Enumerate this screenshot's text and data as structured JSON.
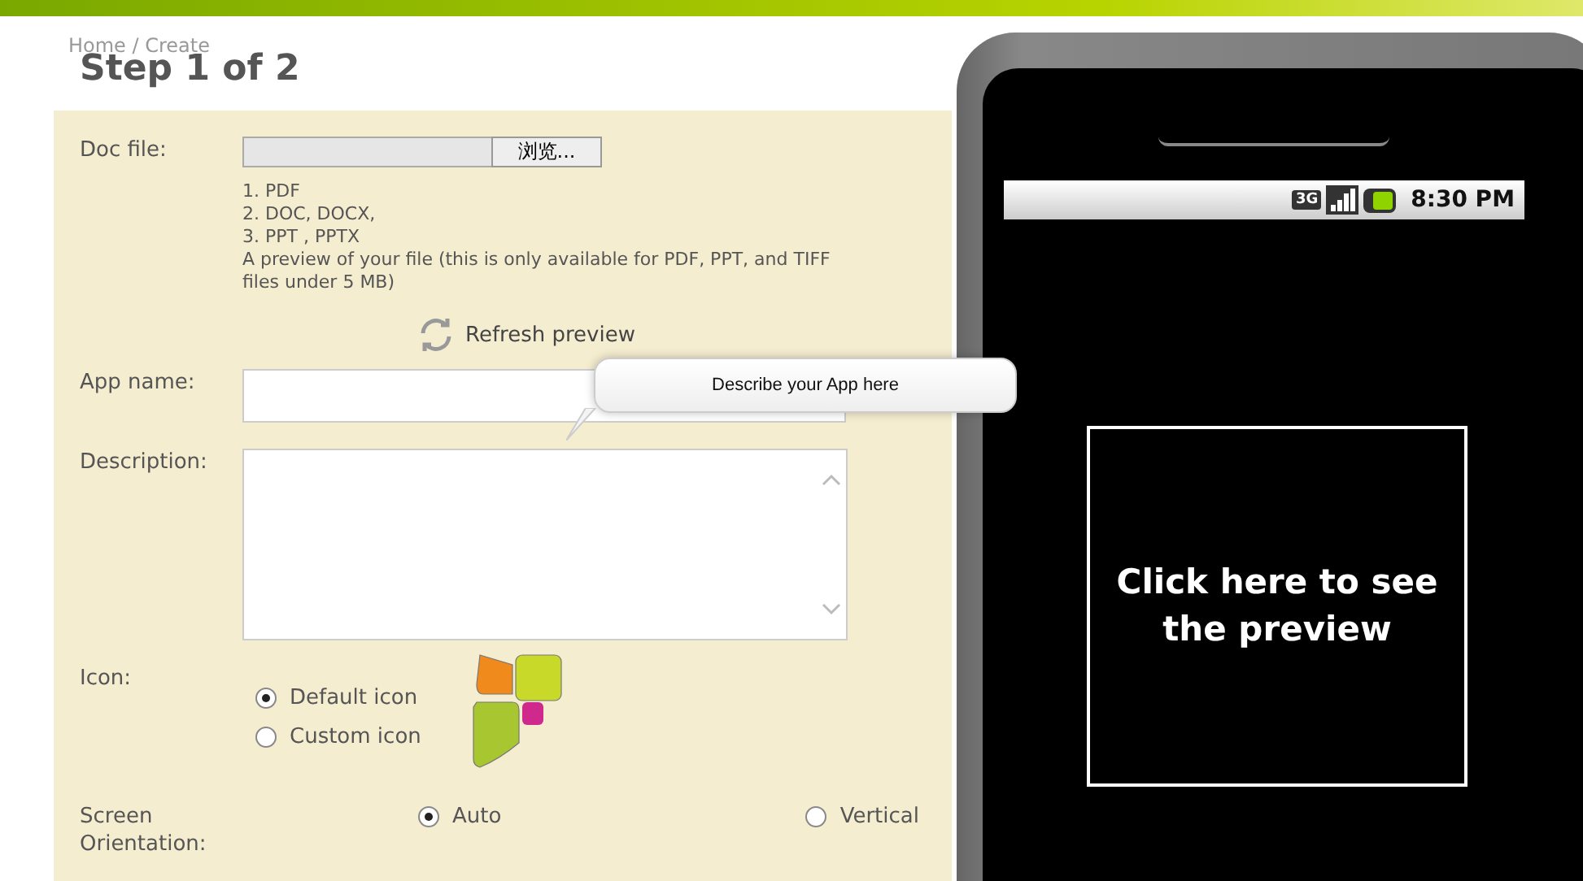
{
  "breadcrumb": "Home / Create",
  "title": "Step 1 of 2",
  "doc_file": {
    "label": "Doc file:",
    "button": "浏览...",
    "formats": [
      "1. PDF",
      "2. DOC, DOCX,",
      "3. PPT , PPTX"
    ],
    "note": "A preview of your file (this is only available for PDF, PPT, and TIFF files under 5 MB)",
    "refresh": "Refresh preview"
  },
  "app_name": {
    "label": "App name:",
    "tooltip": "Describe your App here"
  },
  "description": {
    "label": "Description:"
  },
  "icon": {
    "label": "Icon:",
    "options": [
      {
        "label": "Default icon",
        "selected": true
      },
      {
        "label": "Custom icon",
        "selected": false
      }
    ]
  },
  "orientation": {
    "label_lines": [
      "Screen",
      "Orientation:"
    ],
    "options": [
      {
        "label": "Auto",
        "selected": true
      },
      {
        "label": "Vertical",
        "selected": false
      }
    ]
  },
  "phone": {
    "network": "3G",
    "time": "8:30 PM",
    "preview": "Click here to see the preview"
  }
}
